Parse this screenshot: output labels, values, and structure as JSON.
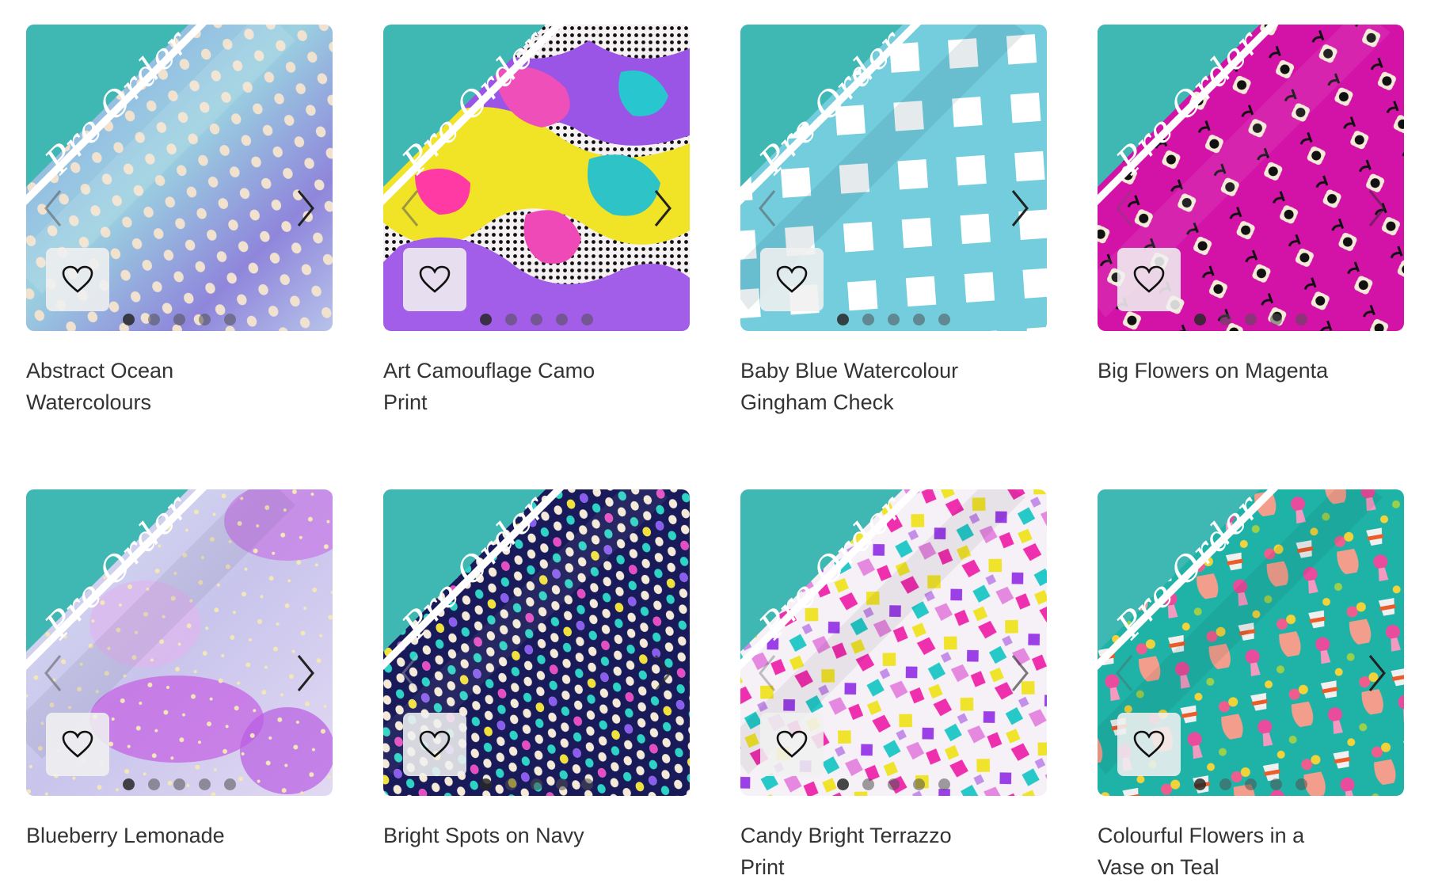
{
  "badge_text": "Pre-Order",
  "colors": {
    "ribbon": "#3fb7b2",
    "title": "#333333",
    "heart_bg": "#f0f0f0"
  },
  "products": [
    {
      "title": "Abstract Ocean Watercolours",
      "pattern": "ocean-dots",
      "dot_count": 5,
      "active_dot": 0
    },
    {
      "title": "Art Camouflage Camo Print",
      "pattern": "camo",
      "dot_count": 5,
      "active_dot": 0
    },
    {
      "title": "Baby Blue Watercolour Gingham Check",
      "pattern": "gingham",
      "dot_count": 5,
      "active_dot": 0
    },
    {
      "title": "Big Flowers on Magenta",
      "pattern": "magenta-flowers",
      "dot_count": 5,
      "active_dot": 0
    },
    {
      "title": "Blueberry Lemonade",
      "pattern": "blueberry",
      "dot_count": 5,
      "active_dot": 0
    },
    {
      "title": "Bright Spots on Navy",
      "pattern": "navy-spots",
      "dot_count": 5,
      "active_dot": 0
    },
    {
      "title": "Candy Bright Terrazzo Print",
      "pattern": "terrazzo",
      "dot_count": 5,
      "active_dot": 0
    },
    {
      "title": "Colourful Flowers in a Vase on Teal",
      "pattern": "teal-vases",
      "dot_count": 5,
      "active_dot": 0
    }
  ],
  "icons": {
    "prev": "chevron-left-icon",
    "next": "chevron-right-icon",
    "wishlist": "heart-icon"
  }
}
